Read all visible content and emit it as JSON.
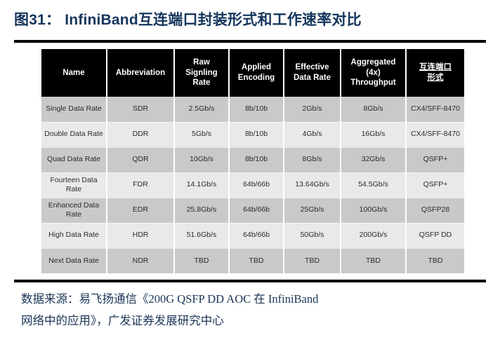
{
  "figure": {
    "title": "图31： InfiniBand互连端口封装形式和工作速率对比",
    "title_color": "#15355c"
  },
  "table": {
    "headers": [
      "Name",
      "Abbreviation",
      "Raw Signling Rate",
      "Applied Encoding",
      "Effective Data Rate",
      "Aggregated (4x) Throughput",
      "互连端口形式"
    ],
    "header_lines": [
      [
        "Name"
      ],
      [
        "Abbreviation"
      ],
      [
        "Raw",
        "Signling",
        "Rate"
      ],
      [
        "Applied",
        "Encoding"
      ],
      [
        "Effective",
        "Data Rate"
      ],
      [
        "Aggregated",
        "(4x)",
        "Throughput"
      ],
      [
        "互连端口",
        "形式"
      ]
    ],
    "header_bg": "#000000",
    "header_fg": "#ffffff",
    "row_bg_odd": "#c9c9c9",
    "row_bg_even": "#e9e9e9",
    "rows": [
      {
        "name": "Single Data Rate",
        "abbreviation": "SDR",
        "raw_signling_rate": "2.5Gb/s",
        "applied_encoding": "8b/10b",
        "effective_data_rate": "2Gb/s",
        "aggregated_4x_throughput": "8Gb/s",
        "port_form": "CX4/SFF-8470"
      },
      {
        "name": "Double Data Rate",
        "abbreviation": "DDR",
        "raw_signling_rate": "5Gb/s",
        "applied_encoding": "8b/10b",
        "effective_data_rate": "4Gb/s",
        "aggregated_4x_throughput": "16Gb/s",
        "port_form": "CX4/SFF-8470"
      },
      {
        "name": "Quad Data Rate",
        "abbreviation": "QDR",
        "raw_signling_rate": "10Gb/s",
        "applied_encoding": "8b/10b",
        "effective_data_rate": "8Gb/s",
        "aggregated_4x_throughput": "32Gb/s",
        "port_form": "QSFP+"
      },
      {
        "name": "Fourteen Data Rate",
        "abbreviation": "FDR",
        "raw_signling_rate": "14.1Gb/s",
        "applied_encoding": "64b/66b",
        "effective_data_rate": "13.64Gb/s",
        "aggregated_4x_throughput": "54.5Gb/s",
        "port_form": "QSFP+"
      },
      {
        "name": "Enhanced Data Rate",
        "abbreviation": "EDR",
        "raw_signling_rate": "25.8Gb/s",
        "applied_encoding": "64b/66b",
        "effective_data_rate": "25Gb/s",
        "aggregated_4x_throughput": "100Gb/s",
        "port_form": "QSFP28"
      },
      {
        "name": "High Data Rate",
        "abbreviation": "HDR",
        "raw_signling_rate": "51.6Gb/s",
        "applied_encoding": "64b/66b",
        "effective_data_rate": "50Gb/s",
        "aggregated_4x_throughput": "200Gb/s",
        "port_form": "QSFP DD"
      },
      {
        "name": "Next Data Rate",
        "abbreviation": "NDR",
        "raw_signling_rate": "TBD",
        "applied_encoding": "TBD",
        "effective_data_rate": "TBD",
        "aggregated_4x_throughput": "TBD",
        "port_form": "TBD"
      }
    ]
  },
  "footer": {
    "source_line_1": "数据来源：易飞扬通信《200G QSFP DD AOC 在 InfiniBand",
    "source_line_2": "网络中的应用》，广发证券发展研究中心"
  }
}
